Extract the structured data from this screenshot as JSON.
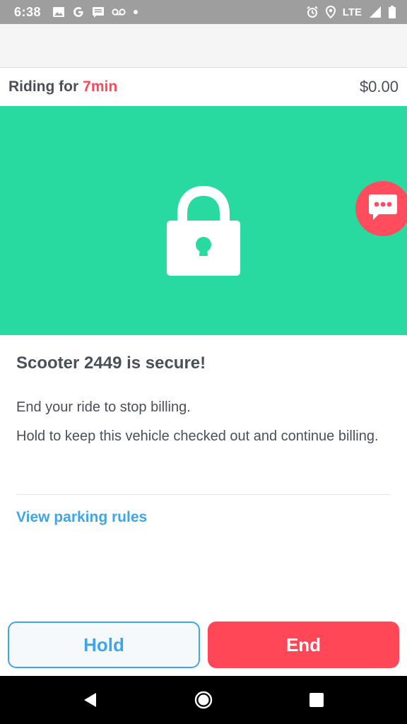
{
  "status_bar": {
    "time": "6:38",
    "network": "LTE",
    "left_icons": [
      "image-icon",
      "google-icon",
      "message-icon",
      "voicemail-icon",
      "dot-icon"
    ],
    "right_icons": [
      "alarm-icon",
      "location-icon",
      "signal-icon",
      "battery-icon"
    ]
  },
  "ride": {
    "label": "Riding for",
    "duration": "7min",
    "cost": "$0.00"
  },
  "hero": {
    "icon": "lock-icon",
    "fab_icon": "chat-bubble-icon",
    "background": "#28d9a0"
  },
  "content": {
    "title": "Scooter 2449 is secure!",
    "line1": "End your ride to stop billing.",
    "line2": "Hold to keep this vehicle checked out and continue billing.",
    "link": "View parking rules"
  },
  "buttons": {
    "hold": "Hold",
    "end": "End"
  },
  "colors": {
    "accent_red": "#ff4757",
    "accent_blue": "#3ea6e8",
    "text": "#4a4f5a"
  },
  "nav": [
    "back-icon",
    "home-icon",
    "recents-icon"
  ]
}
